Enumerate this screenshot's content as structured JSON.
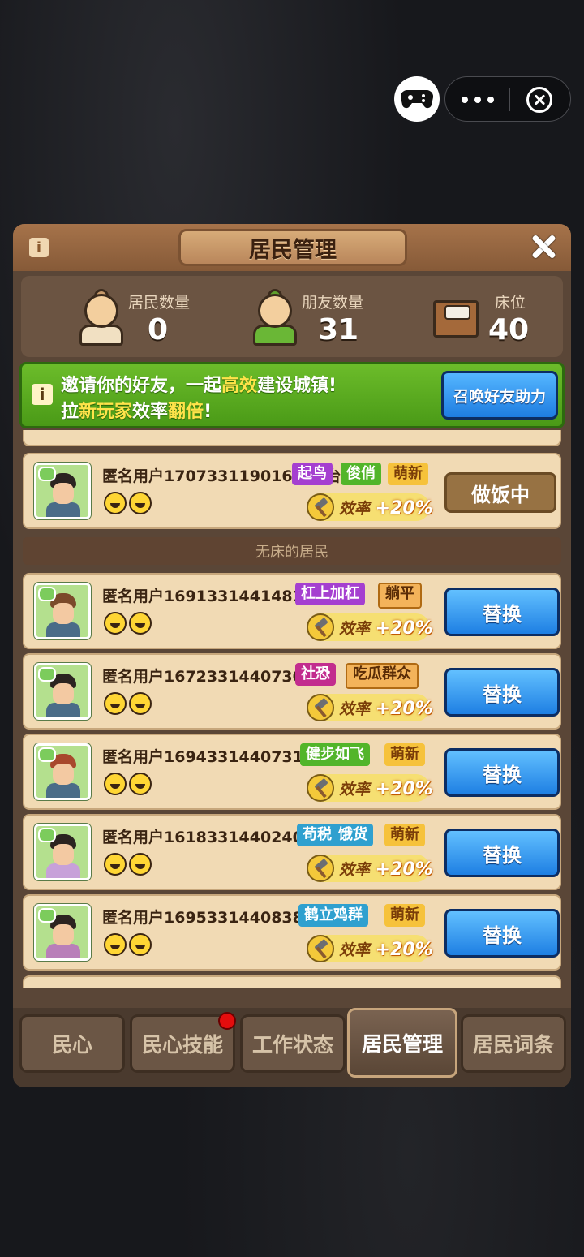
{
  "panel": {
    "title": "居民管理"
  },
  "stats": [
    {
      "label": "居民数量",
      "value": "0",
      "icon": "villager-icon"
    },
    {
      "label": "朋友数量",
      "value": "31",
      "icon": "friend-icon"
    },
    {
      "label": "床位",
      "value": "40",
      "icon": "bed-icon"
    }
  ],
  "invite": {
    "line1_a": "邀请你的好友，一起",
    "line1_hl": "高效",
    "line1_b": "建设城镇!",
    "line2_a": "拉",
    "line2_hl1": "新玩家",
    "line2_b": "效率",
    "line2_hl2": "翻倍",
    "line2_c": "!",
    "button": "召唤好友助力"
  },
  "efficiency_label": "效率",
  "efficiency_value": "+20%",
  "working": [
    {
      "name": "匿名用户1707331190166(灶台)",
      "tags": [
        "起鸟",
        "俊俏",
        "萌新"
      ],
      "action": "做饭中"
    }
  ],
  "section_no_bed": "无床的居民",
  "residents": [
    {
      "name": "匿名用户1691331441481",
      "tags": [
        "杠上加杠",
        "躺平"
      ],
      "action": "替换"
    },
    {
      "name": "匿名用户1672331440730",
      "tags": [
        "社恐",
        "吃瓜群众"
      ],
      "action": "替换"
    },
    {
      "name": "匿名用户1694331440731",
      "tags": [
        "健步如飞",
        "萌新"
      ],
      "action": "替换"
    },
    {
      "name": "匿名用户1618331440240",
      "tags": [
        "苟税",
        "饿货",
        "萌新"
      ],
      "action": "替换"
    },
    {
      "name": "匿名用户1695331440838",
      "tags": [
        "鹤立鸡群",
        "萌新"
      ],
      "action": "替换"
    }
  ],
  "tabs": [
    "民心",
    "民心技能",
    "工作状态",
    "居民管理",
    "居民词条"
  ],
  "active_tab": "居民管理"
}
